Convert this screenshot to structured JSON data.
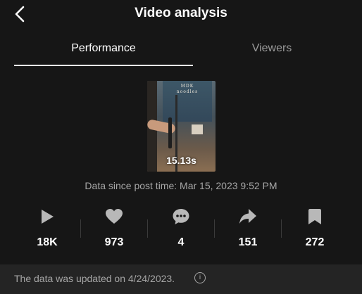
{
  "header": {
    "title": "Video analysis",
    "back_icon": "chevron-left-icon"
  },
  "tabs": [
    {
      "label": "Performance",
      "active": true
    },
    {
      "label": "Viewers",
      "active": false
    }
  ],
  "video": {
    "sign_title": "MDK",
    "sign_subtitle": "noodles",
    "duration": "15.13s"
  },
  "data_since": "Data since post time: Mar 15, 2023 9:52 PM",
  "stats": [
    {
      "icon": "play-icon",
      "value": "18K"
    },
    {
      "icon": "heart-icon",
      "value": "973"
    },
    {
      "icon": "comment-icon",
      "value": "4"
    },
    {
      "icon": "share-icon",
      "value": "151"
    },
    {
      "icon": "bookmark-icon",
      "value": "272"
    }
  ],
  "footer": {
    "updated_text": "The data was updated on 4/24/2023.",
    "info_icon": "info-icon"
  },
  "colors": {
    "background": "#161616",
    "footer_bg": "#242424",
    "muted_text": "#a6a6a6",
    "inactive_tab": "#9a9a9a"
  }
}
